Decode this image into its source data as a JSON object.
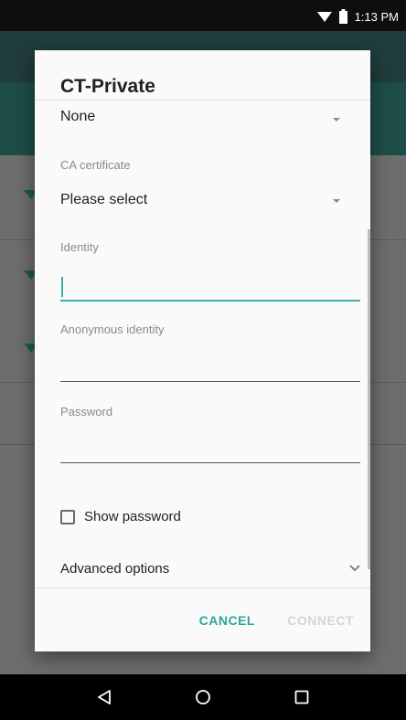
{
  "status_bar": {
    "time": "1:13 PM",
    "wifi_icon": "wifi-icon",
    "battery_icon": "battery-icon"
  },
  "dialog": {
    "title": "CT-Private",
    "phase2": {
      "value": "None"
    },
    "ca_certificate": {
      "label": "CA certificate",
      "value": "Please select"
    },
    "identity": {
      "label": "Identity",
      "value": ""
    },
    "anonymous_identity": {
      "label": "Anonymous identity",
      "value": ""
    },
    "password": {
      "label": "Password",
      "value": ""
    },
    "show_password": {
      "label": "Show password",
      "checked": false
    },
    "advanced_options": {
      "label": "Advanced options"
    },
    "actions": {
      "cancel": "CANCEL",
      "connect": "CONNECT"
    }
  },
  "colors": {
    "accent": "#2aa796",
    "field_active": "#3bb4a6",
    "disabled": "#d4d4d4"
  },
  "nav_bar": {
    "back": "back-icon",
    "home": "home-icon",
    "recents": "recents-icon"
  }
}
